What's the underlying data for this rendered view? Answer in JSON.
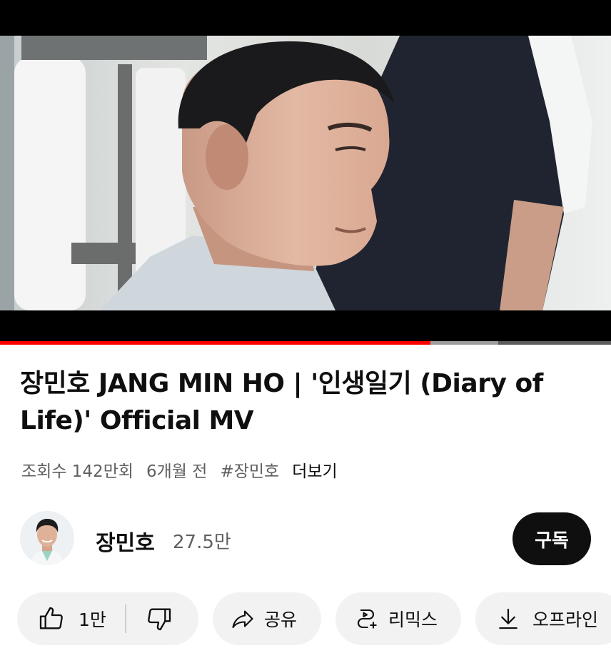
{
  "video": {
    "title": "장민호 JANG MIN HO | '인생일기 (Diary of Life)' Official MV",
    "progress_fraction": 0.705,
    "buffered_fraction": 0.815
  },
  "meta": {
    "views": "조회수 142만회",
    "age": "6개월 전",
    "hashtag": "#장민호",
    "more_label": "더보기"
  },
  "channel": {
    "name": "장민호",
    "subscribers": "27.5만",
    "subscribe_label": "구독"
  },
  "actions": {
    "like_count": "1만",
    "share_label": "공유",
    "remix_label": "리믹스",
    "offline_label": "오프라인"
  },
  "colors": {
    "progress": "#ff0000",
    "pill_background": "#f2f2f2",
    "subscribe_background": "#0f0f0f"
  },
  "icons": {
    "like": "thumbs-up-icon",
    "dislike": "thumbs-down-icon",
    "share": "share-arrow-icon",
    "remix": "remix-icon",
    "offline": "download-icon"
  }
}
